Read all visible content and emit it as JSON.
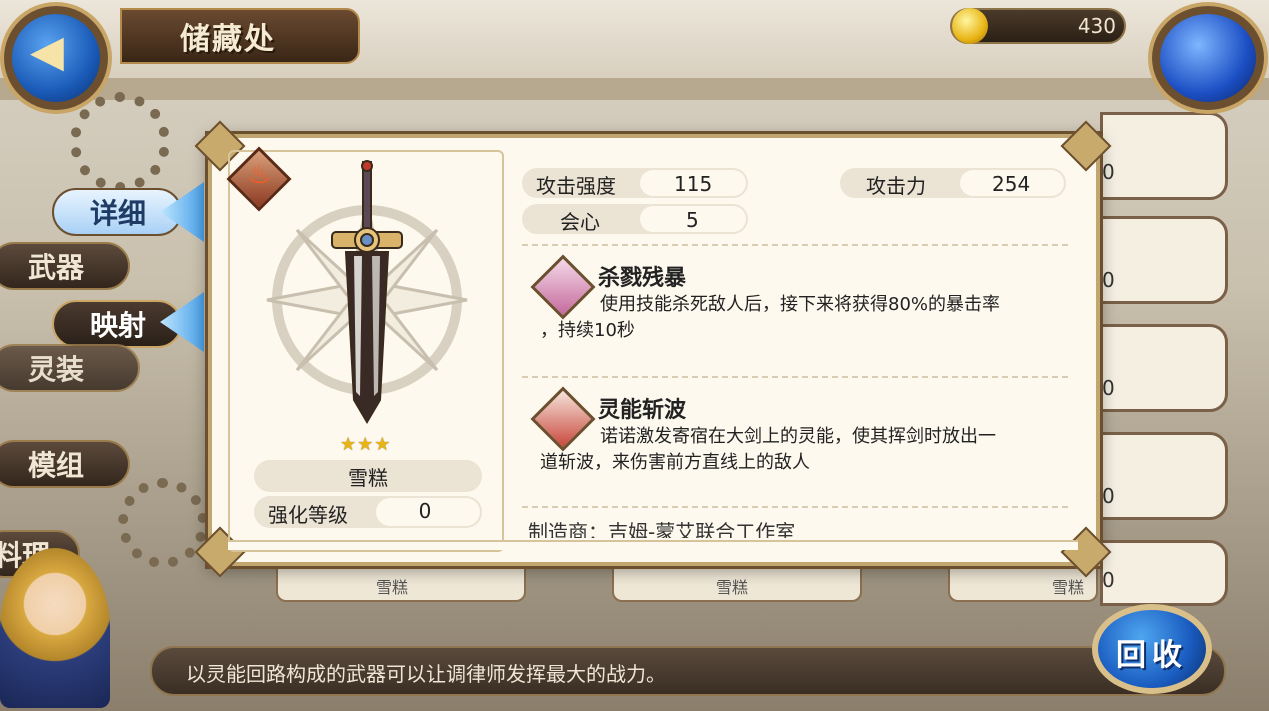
{
  "header": {
    "title": "储藏处",
    "currency_value": "430"
  },
  "side_menu": {
    "items": [
      {
        "label": "详细"
      },
      {
        "label": "武器"
      },
      {
        "label": "映射"
      },
      {
        "label": "灵装"
      },
      {
        "label": "模组"
      },
      {
        "label": "料理"
      }
    ]
  },
  "weapon": {
    "name": "雪糕",
    "stars": "★★★",
    "enhance_label": "强化等级",
    "enhance_value": "0"
  },
  "stats": {
    "attack_strength_label": "攻击强度",
    "attack_strength_value": "115",
    "attack_power_label": "攻击力",
    "attack_power_value": "254",
    "crit_label": "会心",
    "crit_value": "5"
  },
  "skills": [
    {
      "title": "杀戮残暴",
      "desc_line1": "使用技能杀死敌人后，接下来将获得80%的暴击率",
      "desc_line2": "，持续10秒"
    },
    {
      "title": "灵能斩波",
      "desc_line1": "诺诺激发寄宿在大剑上的灵能，使其挥剑时放出一",
      "desc_line2": "道斩波，来伤害前方直线上的敌人"
    }
  ],
  "maker": "制造商：吉姆-蒙艾联合工作室",
  "list_values": [
    "0",
    "0",
    "0",
    "0",
    "0"
  ],
  "under_cards": [
    "雪糕",
    "雪糕",
    "雪糕"
  ],
  "bottom_text": "以灵能回路构成的武器可以让调律师发挥最大的战力。",
  "recycle_label": "回收",
  "colors": {
    "panel_bg": "#fdf9ee",
    "frame": "#c2a670",
    "accent_blue": "#1a5cc0",
    "gold": "#e8b414"
  }
}
